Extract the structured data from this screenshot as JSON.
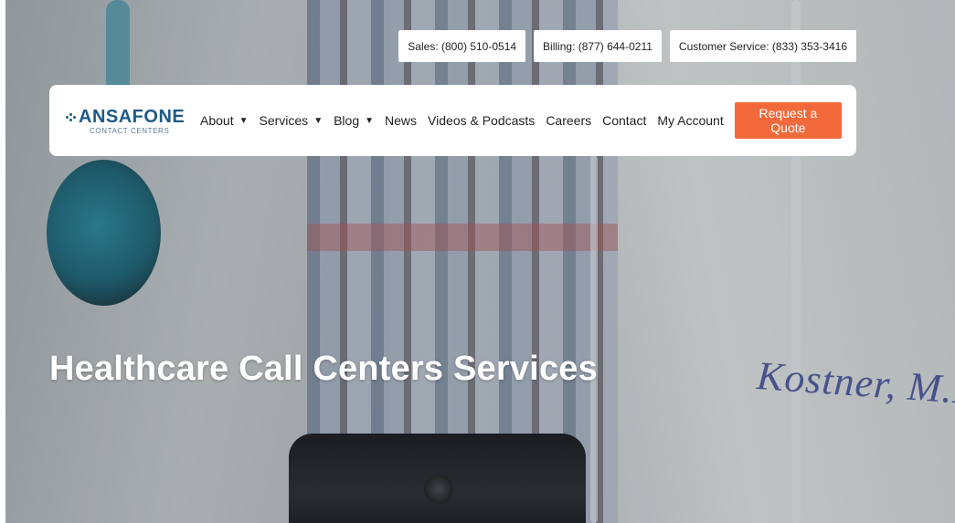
{
  "phone_bar": {
    "sales": "Sales: (800) 510-0514",
    "billing": "Billing: (877) 644-0211",
    "customer_service": "Customer Service: (833) 353-3416"
  },
  "logo": {
    "name": "ANSAFONE",
    "tagline": "CONTACT CENTERS"
  },
  "nav": {
    "items": [
      {
        "label": "About",
        "dropdown": true
      },
      {
        "label": "Services",
        "dropdown": true
      },
      {
        "label": "Blog",
        "dropdown": true
      },
      {
        "label": "News",
        "dropdown": false
      },
      {
        "label": "Videos & Podcasts",
        "dropdown": false
      },
      {
        "label": "Careers",
        "dropdown": false
      },
      {
        "label": "Contact",
        "dropdown": false
      },
      {
        "label": "My Account",
        "dropdown": false
      }
    ],
    "caret_glyph": "▼",
    "cta_label": "Request a Quote"
  },
  "hero": {
    "title": "Healthcare Call Centers Services",
    "embroidery": "Kostner, M.D."
  },
  "colors": {
    "brand_blue": "#1d5a86",
    "cta_orange": "#f26a3b"
  }
}
